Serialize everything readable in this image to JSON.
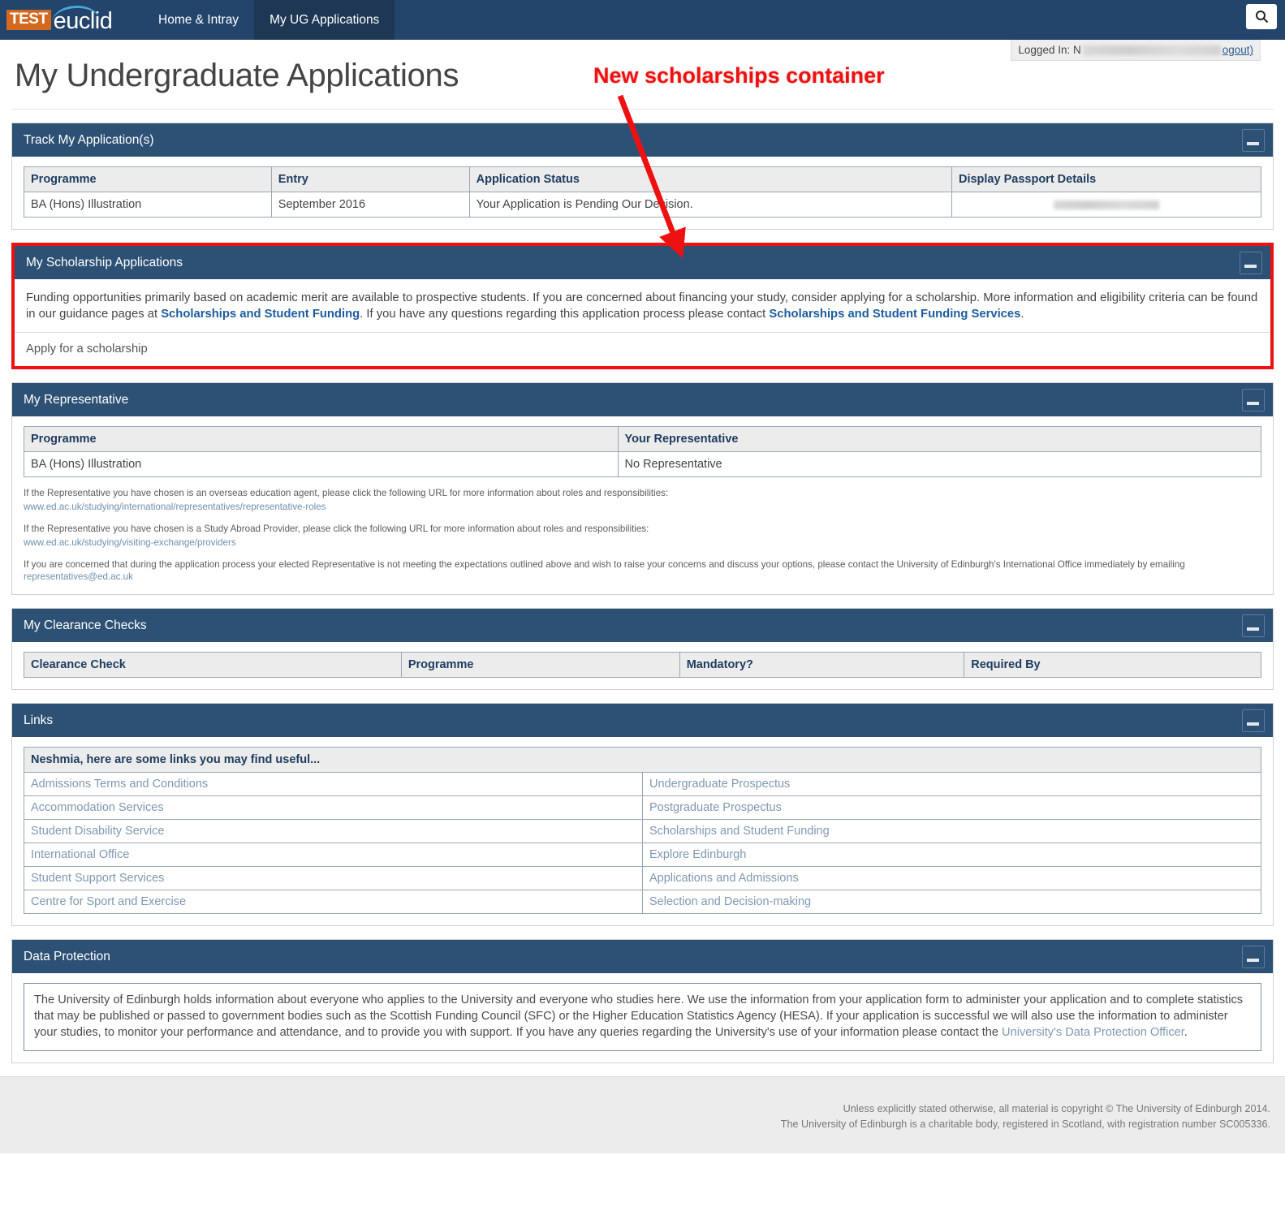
{
  "nav": {
    "brand_test": "TEST",
    "brand_name": "euclid",
    "items": [
      {
        "label": "Home & Intray",
        "active": false
      },
      {
        "label": "My UG Applications",
        "active": true
      }
    ],
    "search_icon": "search-icon"
  },
  "session": {
    "logged_in_prefix": "Logged In: N",
    "logged_in_name_redacted": true,
    "logout_label": "ogout)"
  },
  "page": {
    "title": "My Undergraduate Applications"
  },
  "annotation": {
    "text": "New scholarships container",
    "color": "#ee1111"
  },
  "panels": {
    "track": {
      "title": "Track My Application(s)",
      "collapse_icon": "minimize-icon",
      "columns": [
        "Programme",
        "Entry",
        "Application Status",
        "Display Passport Details"
      ],
      "rows": [
        {
          "programme": "BA (Hons) Illustration",
          "entry": "September 2016",
          "status": "Your Application is Pending Our Decision.",
          "passport": ""
        }
      ]
    },
    "scholarships": {
      "title": "My Scholarship Applications",
      "collapse_icon": "minimize-icon",
      "intro_part1": "Funding opportunities primarily based on academic merit are available to prospective students. If you are concerned about financing your study, consider applying for a scholarship. More information and eligibility criteria can be found in our guidance pages at ",
      "link1": "Scholarships and Student Funding",
      "intro_part2": ". If you have any questions regarding this application process please contact ",
      "link2": "Scholarships and Student Funding Services",
      "intro_part3": ".",
      "apply_label": "Apply for a scholarship"
    },
    "representative": {
      "title": "My Representative",
      "collapse_icon": "minimize-icon",
      "columns": [
        "Programme",
        "Your Representative"
      ],
      "rows": [
        {
          "programme": "BA (Hons) Illustration",
          "representative": "No Representative"
        }
      ],
      "note1": "If the Representative you have chosen is an overseas education agent, please click the following URL for more information about roles and responsibilities:",
      "url1": "www.ed.ac.uk/studying/international/representatives/representative-roles",
      "note2": "If the Representative you have chosen is a Study Abroad Provider, please click the following URL for more information about roles and responsibilities:",
      "url2": "www.ed.ac.uk/studying/visiting-exchange/providers",
      "note3_part1": "If you are concerned that during the application process your elected Representative is not meeting the expectations outlined above and wish to raise your concerns and discuss your options, please contact the University of Edinburgh's International Office immediately by emailing ",
      "note3_email": "representatives@ed.ac.uk"
    },
    "clearance": {
      "title": "My Clearance Checks",
      "collapse_icon": "minimize-icon",
      "columns": [
        "Clearance Check",
        "Programme",
        "Mandatory?",
        "Required By"
      ],
      "rows": []
    },
    "links": {
      "title": "Links",
      "collapse_icon": "minimize-icon",
      "table_header": "Neshmia, here are some links you may find useful...",
      "rows": [
        {
          "left": "Admissions Terms and Conditions",
          "right": "Undergraduate Prospectus"
        },
        {
          "left": "Accommodation Services",
          "right": "Postgraduate Prospectus"
        },
        {
          "left": "Student Disability Service",
          "right": "Scholarships and Student Funding"
        },
        {
          "left": "International Office",
          "right": "Explore Edinburgh"
        },
        {
          "left": "Student Support Services",
          "right": "Applications and Admissions"
        },
        {
          "left": "Centre for Sport and Exercise",
          "right": "Selection and Decision-making"
        }
      ]
    },
    "data_protection": {
      "title": "Data Protection",
      "collapse_icon": "minimize-icon",
      "body_part1": "The University of Edinburgh holds information about everyone who applies to the University and everyone who studies here. We use the information from your application form to administer your application and to complete statistics that may be published or passed to government bodies such as the Scottish Funding Council (SFC) or the Higher Education Statistics Agency (HESA). If your application is successful we will also use the information to administer your studies, to monitor your performance and attendance, and to provide you with support. If you have any queries regarding the University's use of your information please contact the ",
      "body_link": "University's Data Protection Officer",
      "body_part2": "."
    }
  },
  "footer": {
    "line1": "Unless explicitly stated otherwise, all material is copyright © The University of Edinburgh 2014.",
    "line2": "The University of Edinburgh is a charitable body, registered in Scotland, with registration number SC005336."
  }
}
